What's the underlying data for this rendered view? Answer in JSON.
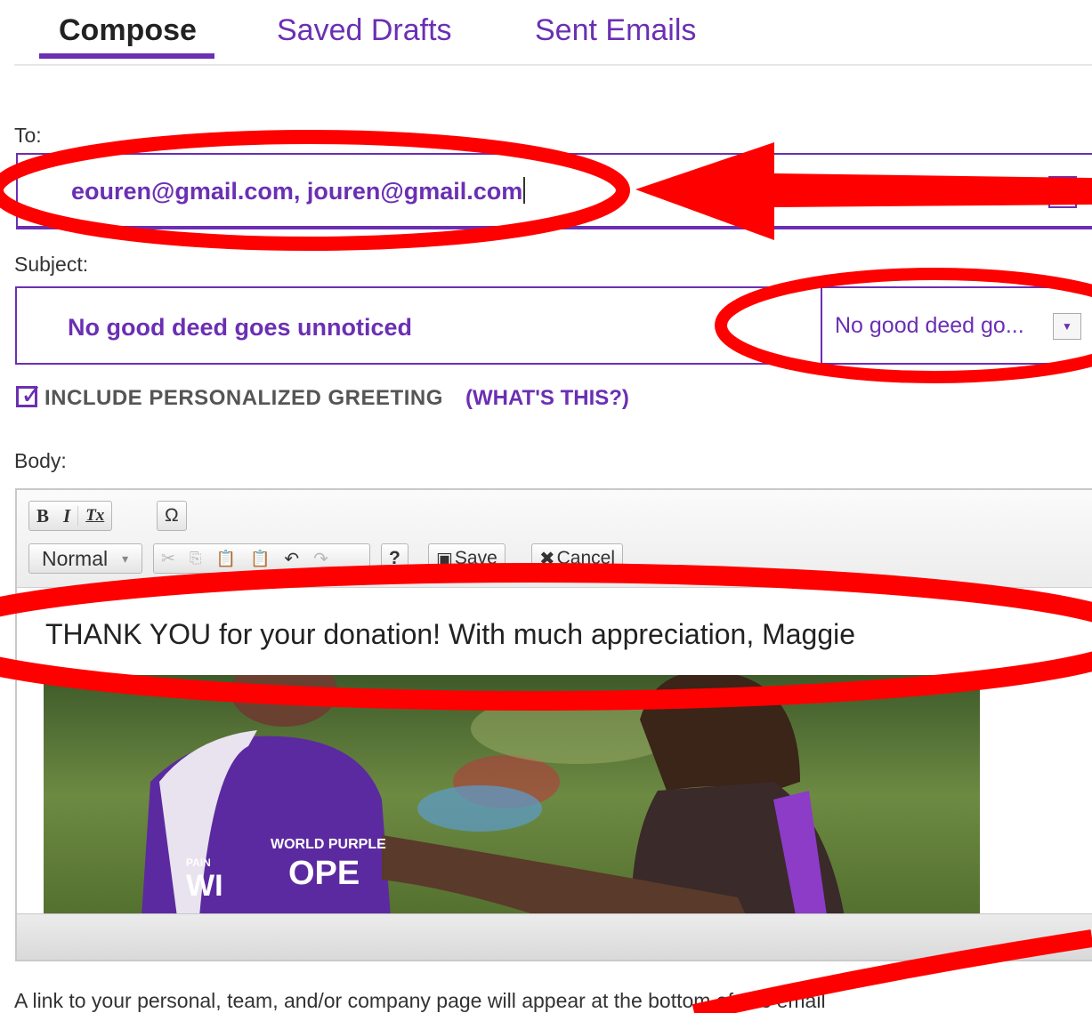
{
  "tabs": [
    {
      "label": "Compose",
      "active": true
    },
    {
      "label": "Saved Drafts",
      "active": false
    },
    {
      "label": "Sent Emails",
      "active": false
    }
  ],
  "to": {
    "label": "To:",
    "value": "eouren@gmail.com, jouren@gmail.com"
  },
  "subject": {
    "label": "Subject:",
    "value": "No good deed goes unnoticed",
    "template_selected": "No good deed go...",
    "dropdown_icon": "triangle-down-icon"
  },
  "greeting": {
    "checked": true,
    "label": "INCLUDE PERSONALIZED GREETING",
    "help_link": "(WHAT'S THIS?)"
  },
  "body": {
    "label": "Body:",
    "toolbar": {
      "bold": "B",
      "italic": "I",
      "remove_format": "Tx",
      "special_char": "Ω",
      "format_select": "Normal",
      "help": "?",
      "save": "Save",
      "cancel": "Cancel"
    },
    "text": "THANK YOU for your donation! With much appreciation, Maggie",
    "image_text": {
      "line1": "WORLD PURPLE",
      "line2": "WI",
      "line3": "OPE",
      "line4": "PAIN"
    }
  },
  "footer_note": "A link to your personal, team, and/or company page will appear at the bottom of this email",
  "colors": {
    "brand_purple": "#6b2fb3",
    "annotation_red": "#ff0000"
  }
}
